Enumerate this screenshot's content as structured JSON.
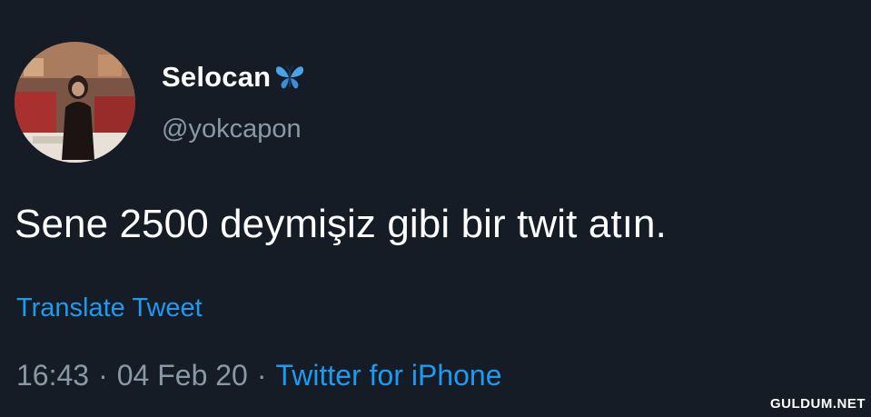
{
  "user": {
    "display_name": "Selocan",
    "name_emoji": "butterfly-icon",
    "handle": "@yokcapon",
    "avatar": "avatar-photo"
  },
  "tweet": {
    "text": "Sene 2500 deymişiz gibi bir twit atın.",
    "translate_label": "Translate Tweet"
  },
  "meta": {
    "time": "16:43",
    "date": "04 Feb 20",
    "separator": "·",
    "source": "Twitter for iPhone"
  },
  "watermark": "GULDUM.NET",
  "colors": {
    "background": "#151c26",
    "text": "#ffffff",
    "muted": "#8899a6",
    "link": "#1d9bf0",
    "butterfly": "#4aa3e8"
  }
}
